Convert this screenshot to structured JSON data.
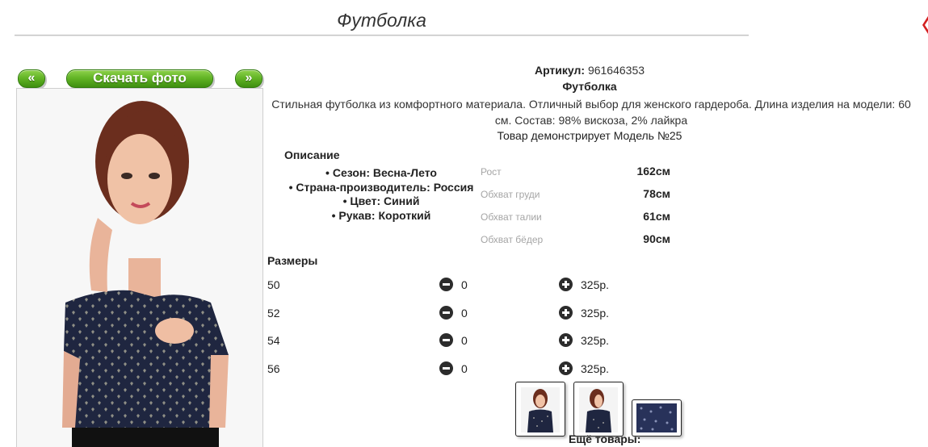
{
  "page": {
    "title": "Футболка"
  },
  "gallery": {
    "prev_label": "«",
    "download_label": "Скачать фото",
    "next_label": "»"
  },
  "product": {
    "sku_label": "Артикул:",
    "sku_value": "961646353",
    "name": "Футболка",
    "description": "Стильная футболка из комфортного материала. Отличный выбор для женского гардероба. Длина изделия на модели: 60 см. Состав: 98% вискоза, 2% лайкра",
    "model_demo": "Товар демонстрирует Модель №25"
  },
  "description_section": {
    "heading": "Описание",
    "attributes": [
      "Сезон: Весна-Лето",
      "Страна-производитель: Россия",
      "Цвет: Синий",
      "Рукав: Короткий"
    ]
  },
  "measurements": [
    {
      "label": "Рост",
      "value": "162см"
    },
    {
      "label": "Обхват груди",
      "value": "78см"
    },
    {
      "label": "Обхват талии",
      "value": "61см"
    },
    {
      "label": "Обхват бёдер",
      "value": "90см"
    }
  ],
  "sizes": {
    "heading": "Размеры",
    "rows": [
      {
        "size": "50",
        "qty": "0",
        "price": "325р."
      },
      {
        "size": "52",
        "qty": "0",
        "price": "325р."
      },
      {
        "size": "54",
        "qty": "0",
        "price": "325р."
      },
      {
        "size": "56",
        "qty": "0",
        "price": "325р."
      }
    ]
  },
  "more_label": "Ещё товары:",
  "colors": {
    "button_green": "#63b526",
    "shirt_navy": "#1f2640"
  },
  "icons": [
    "minus-circle-icon",
    "plus-circle-icon"
  ]
}
